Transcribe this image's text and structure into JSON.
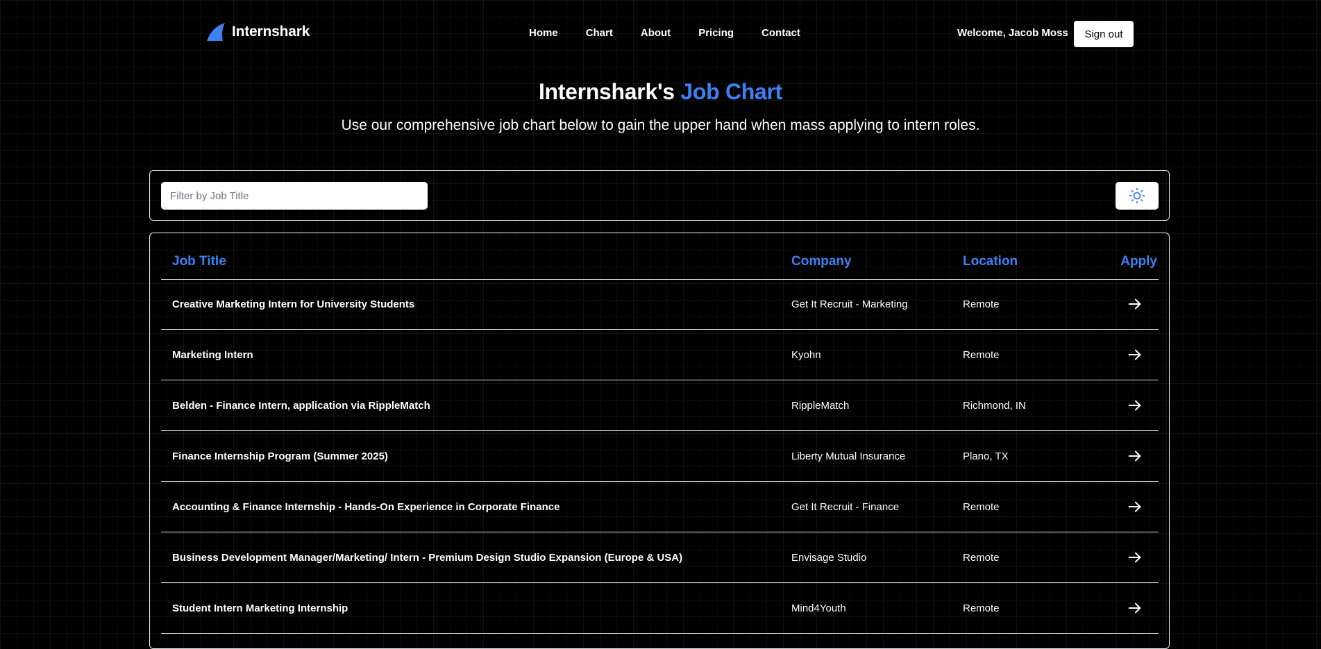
{
  "brand": {
    "name": "Internshark",
    "logo_icon": "shark-fin-icon",
    "logo_color": "#3b82f6"
  },
  "nav": {
    "links": [
      "Home",
      "Chart",
      "About",
      "Pricing",
      "Contact"
    ]
  },
  "user": {
    "welcome": "Welcome, Jacob Moss",
    "signout_label": "Sign out"
  },
  "hero": {
    "title_prefix": "Internshark's ",
    "title_accent": "Job Chart",
    "subtitle": "Use our comprehensive job chart below to gain the upper hand when mass applying to intern roles."
  },
  "filter": {
    "placeholder": "Filter by Job Title",
    "value": "",
    "theme_toggle_icon": "sun-icon"
  },
  "table": {
    "headers": {
      "title": "Job Title",
      "company": "Company",
      "location": "Location",
      "apply": "Apply"
    },
    "apply_icon": "arrow-right-icon",
    "rows": [
      {
        "title": "Creative Marketing Intern for University Students",
        "company": "Get It Recruit - Marketing",
        "location": "Remote"
      },
      {
        "title": "Marketing Intern",
        "company": "Kyohn",
        "location": "Remote"
      },
      {
        "title": "Belden - Finance Intern, application via RippleMatch",
        "company": "RippleMatch",
        "location": "Richmond, IN"
      },
      {
        "title": "Finance Internship Program (Summer 2025)",
        "company": "Liberty Mutual Insurance",
        "location": "Plano, TX"
      },
      {
        "title": "Accounting & Finance Internship - Hands-On Experience in Corporate Finance",
        "company": "Get It Recruit - Finance",
        "location": "Remote"
      },
      {
        "title": "Business Development Manager/Marketing/ Intern - Premium Design Studio Expansion (Europe & USA)",
        "company": "Envisage Studio",
        "location": "Remote"
      },
      {
        "title": "Student Intern Marketing Internship",
        "company": "Mind4Youth",
        "location": "Remote"
      }
    ]
  },
  "colors": {
    "background": "#000000",
    "accent": "#3b82f6",
    "border": "#e5e7eb"
  }
}
